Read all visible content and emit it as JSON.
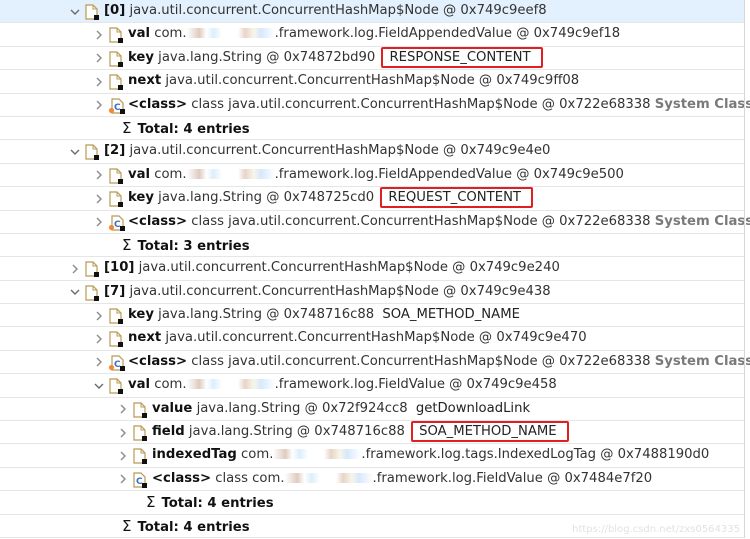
{
  "rows": [
    {
      "level": 0,
      "expand": "expanded",
      "icon": "field-object-icon",
      "selected": true,
      "name": "[0]",
      "type": "java.util.concurrent.ConcurrentHashMap$Node @ 0x749c9eef8"
    },
    {
      "level": 1,
      "expand": "collapsed",
      "icon": "field-object-icon",
      "name": "val",
      "type_prefix": "com.",
      "obfuscated": true,
      "type": ".framework.log.FieldAppendedValue @ 0x749c9ef18"
    },
    {
      "level": 1,
      "expand": "collapsed",
      "icon": "field-object-icon",
      "name": "key",
      "type": "java.lang.String @ 0x74872bd90",
      "value": "RESPONSE_CONTENT",
      "highlight": true
    },
    {
      "level": 1,
      "expand": "collapsed",
      "icon": "field-object-icon",
      "name": "next",
      "type": "java.util.concurrent.ConcurrentHashMap$Node @ 0x749c9ff08"
    },
    {
      "level": 1,
      "expand": "collapsed",
      "icon": "class-icon",
      "name": "<class>",
      "type": "class java.util.concurrent.ConcurrentHashMap$Node @ 0x722e68338",
      "suffix": "System Class"
    },
    {
      "level": 1,
      "expand": "none",
      "icon": "sigma-icon",
      "total": "Total: 4 entries"
    },
    {
      "level": 0,
      "expand": "expanded",
      "icon": "field-object-icon",
      "name": "[2]",
      "type": "java.util.concurrent.ConcurrentHashMap$Node @ 0x749c9e4e0"
    },
    {
      "level": 1,
      "expand": "collapsed",
      "icon": "field-object-icon",
      "name": "val",
      "type_prefix": "com.",
      "obfuscated": true,
      "type": ".framework.log.FieldAppendedValue @ 0x749c9e500"
    },
    {
      "level": 1,
      "expand": "collapsed",
      "icon": "field-object-icon",
      "name": "key",
      "type": "java.lang.String @ 0x748725cd0",
      "value": "REQUEST_CONTENT",
      "highlight": true
    },
    {
      "level": 1,
      "expand": "collapsed",
      "icon": "class-icon",
      "name": "<class>",
      "type": "class java.util.concurrent.ConcurrentHashMap$Node @ 0x722e68338",
      "suffix": "System Class"
    },
    {
      "level": 1,
      "expand": "none",
      "icon": "sigma-icon",
      "total": "Total: 3 entries"
    },
    {
      "level": 0,
      "expand": "collapsed",
      "icon": "field-object-icon",
      "name": "[10]",
      "type": "java.util.concurrent.ConcurrentHashMap$Node @ 0x749c9e240"
    },
    {
      "level": 0,
      "expand": "expanded",
      "icon": "field-object-icon",
      "name": "[7]",
      "type": "java.util.concurrent.ConcurrentHashMap$Node @ 0x749c9e438"
    },
    {
      "level": 1,
      "expand": "collapsed",
      "icon": "field-object-icon",
      "name": "key",
      "type": "java.lang.String @ 0x748716c88",
      "value": "SOA_METHOD_NAME",
      "highlight": false
    },
    {
      "level": 1,
      "expand": "collapsed",
      "icon": "field-object-icon",
      "name": "next",
      "type": "java.util.concurrent.ConcurrentHashMap$Node @ 0x749c9e470"
    },
    {
      "level": 1,
      "expand": "collapsed",
      "icon": "class-icon",
      "name": "<class>",
      "type": "class java.util.concurrent.ConcurrentHashMap$Node @ 0x722e68338",
      "suffix": "System Class"
    },
    {
      "level": 1,
      "expand": "expanded",
      "icon": "field-object-icon",
      "name": "val",
      "type_prefix": "com.",
      "obfuscated": true,
      "type": ".framework.log.FieldValue @ 0x749c9e458"
    },
    {
      "level": 2,
      "expand": "collapsed",
      "icon": "field-object-icon",
      "name": "value",
      "type": "java.lang.String @ 0x72f924cc8",
      "value": "getDownloadLink",
      "highlight": false
    },
    {
      "level": 2,
      "expand": "collapsed",
      "icon": "field-object-icon",
      "name": "field",
      "type": "java.lang.String @ 0x748716c88",
      "value": "SOA_METHOD_NAME",
      "highlight": true
    },
    {
      "level": 2,
      "expand": "collapsed",
      "icon": "field-object-icon",
      "name": "indexedTag",
      "type_prefix": "com.",
      "obfuscated": true,
      "type": ".framework.log.tags.IndexedLogTag @ 0x7488190d0"
    },
    {
      "level": 2,
      "expand": "collapsed",
      "icon": "class-icon-plain",
      "name": "<class>",
      "type_prefix": "class com.",
      "obfuscated": true,
      "type": ".framework.log.FieldValue @ 0x7484e7f20"
    },
    {
      "level": 2,
      "expand": "none",
      "icon": "sigma-icon",
      "total": "Total: 4 entries"
    },
    {
      "level": 1,
      "expand": "none",
      "icon": "sigma-icon",
      "total": "Total: 4 entries"
    }
  ],
  "watermark": "https://blog.csdn.net/zxs0564335"
}
